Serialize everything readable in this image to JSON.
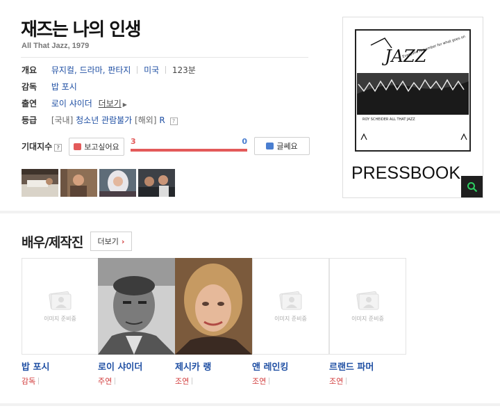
{
  "movie": {
    "title": "재즈는 나의 인생",
    "subtitle": "All That Jazz, 1979"
  },
  "info": {
    "overview_label": "개요",
    "genre": "뮤지컬, 드라마, 판타지",
    "country": "미국",
    "runtime": "123분",
    "director_label": "감독",
    "director": "밥 포시",
    "cast_label": "출연",
    "cast_name": "로이 샤이더",
    "cast_more": "더보기",
    "rating_label": "등급",
    "rating_domestic_prefix": "[국내]",
    "rating_domestic": "청소년 관람불가",
    "rating_overseas_prefix": "[해외]",
    "rating_overseas": "R",
    "help_mark": "?"
  },
  "expectation": {
    "label": "기대지수",
    "want_button": "보고싶어요",
    "dislike_button": "글쎄요",
    "want_count": "3",
    "dislike_count": "0",
    "want_ratio": 1.0,
    "want_color": "#e35a5a",
    "dislike_color": "#4a7ed0"
  },
  "poster": {
    "pressbook_text": "PRESSBOOK",
    "zoom_icon": "search-icon"
  },
  "cast_section": {
    "title": "배우/제작진",
    "more_label": "더보기",
    "no_image_text": "이미지 준비중",
    "members": [
      {
        "name": "밥 포시",
        "role": "감독"
      },
      {
        "name": "로이 샤이더",
        "role": "주연"
      },
      {
        "name": "제시카 랭",
        "role": "조연"
      },
      {
        "name": "앤 레인킹",
        "role": "조연"
      },
      {
        "name": "르랜드 파머",
        "role": "조연"
      }
    ]
  },
  "colors": {
    "link": "#1f4fa3",
    "role": "#d13a3a",
    "accent_red": "#e35a5a"
  }
}
